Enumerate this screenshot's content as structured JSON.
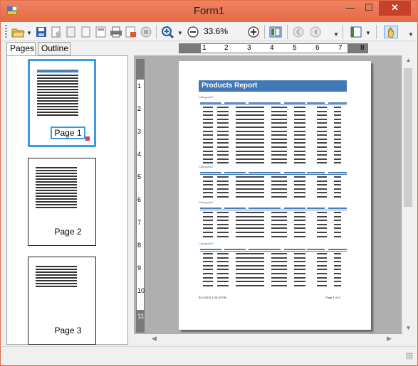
{
  "window": {
    "title": "Form1",
    "minimize": "—",
    "maximize": "☐",
    "close": "✕"
  },
  "toolbar": {
    "zoom_value": "33.6%",
    "icons": [
      "open-folder-icon",
      "save-icon",
      "export-icon",
      "copy-icon",
      "page-setup-icon",
      "print-icon",
      "print-preview-icon",
      "stop-icon",
      "zoom-in-icon",
      "zoom-out-icon",
      "zoom-increase-icon",
      "thumbnail-toggle-icon",
      "first-page-icon",
      "previous-page-icon",
      "page-view-icon",
      "hand-tool-icon"
    ]
  },
  "tabs": [
    {
      "label": "Pages"
    },
    {
      "label": "Outline"
    }
  ],
  "ruler": {
    "numbers": [
      "1",
      "2",
      "3",
      "4",
      "5",
      "6",
      "7",
      "8"
    ],
    "vnumbers": [
      "1",
      "2",
      "3",
      "4",
      "5",
      "6",
      "7",
      "8",
      "9",
      "10",
      "11"
    ]
  },
  "thumbnails": [
    {
      "label": "Page 1",
      "selected": true
    },
    {
      "label": "Page 2"
    },
    {
      "label": "Page 3"
    }
  ],
  "report": {
    "title": "Products Report",
    "group_label": "CategoryID",
    "footer_left": "5/11/2015 1:05:33 PM",
    "footer_right": "Page 1 of 3"
  },
  "colors": {
    "titlebar": "#e56a45",
    "accent": "#3c9be0",
    "report_header": "#4178b6"
  }
}
